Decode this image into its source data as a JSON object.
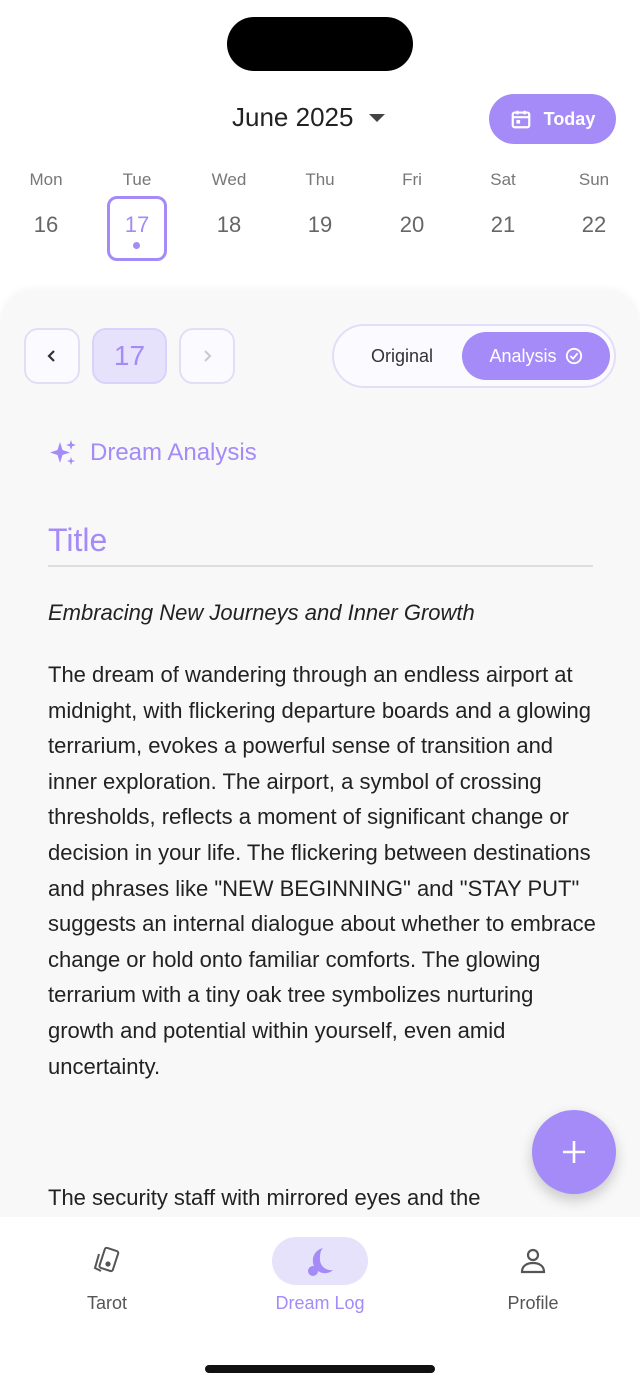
{
  "header": {
    "month_label": "June 2025",
    "today_label": "Today"
  },
  "week": [
    {
      "name": "Mon",
      "date": "16",
      "selected": false
    },
    {
      "name": "Tue",
      "date": "17",
      "selected": true
    },
    {
      "name": "Wed",
      "date": "18",
      "selected": false
    },
    {
      "name": "Thu",
      "date": "19",
      "selected": false
    },
    {
      "name": "Fri",
      "date": "20",
      "selected": false
    },
    {
      "name": "Sat",
      "date": "21",
      "selected": false
    },
    {
      "name": "Sun",
      "date": "22",
      "selected": false
    }
  ],
  "entry_nav": {
    "current_day": "17",
    "prev_icon": "chevron-left-icon",
    "next_icon": "chevron-right-icon"
  },
  "view_toggle": {
    "original_label": "Original",
    "analysis_label": "Analysis",
    "selected": "Analysis"
  },
  "analysis": {
    "section_label": "Dream Analysis",
    "title_label": "Title",
    "dream_title": "Embracing New Journeys and Inner Growth",
    "body": "The dream of wandering through an endless airport at midnight, with flickering departure boards and a glowing terrarium, evokes a powerful sense of transition and inner exploration. The airport, a symbol of crossing thresholds, reflects a moment of significant change or decision in your life. The flickering between destinations and phrases like \"NEW BEGINNING\" and \"STAY PUT\" suggests an internal dialogue about whether to embrace change or hold onto familiar comforts. The glowing terrarium with a tiny oak tree symbolizes nurturing growth and potential within yourself, even amid uncertainty.",
    "body_next_partial": "The security staff with mirrored eyes and the"
  },
  "tabs": [
    {
      "label": "Tarot",
      "icon": "tarot-cards-icon",
      "active": false
    },
    {
      "label": "Dream Log",
      "icon": "moon-icon",
      "active": true
    },
    {
      "label": "Profile",
      "icon": "person-icon",
      "active": false
    }
  ],
  "colors": {
    "accent": "#a48bf7",
    "accent_light": "#e7e2fc"
  }
}
